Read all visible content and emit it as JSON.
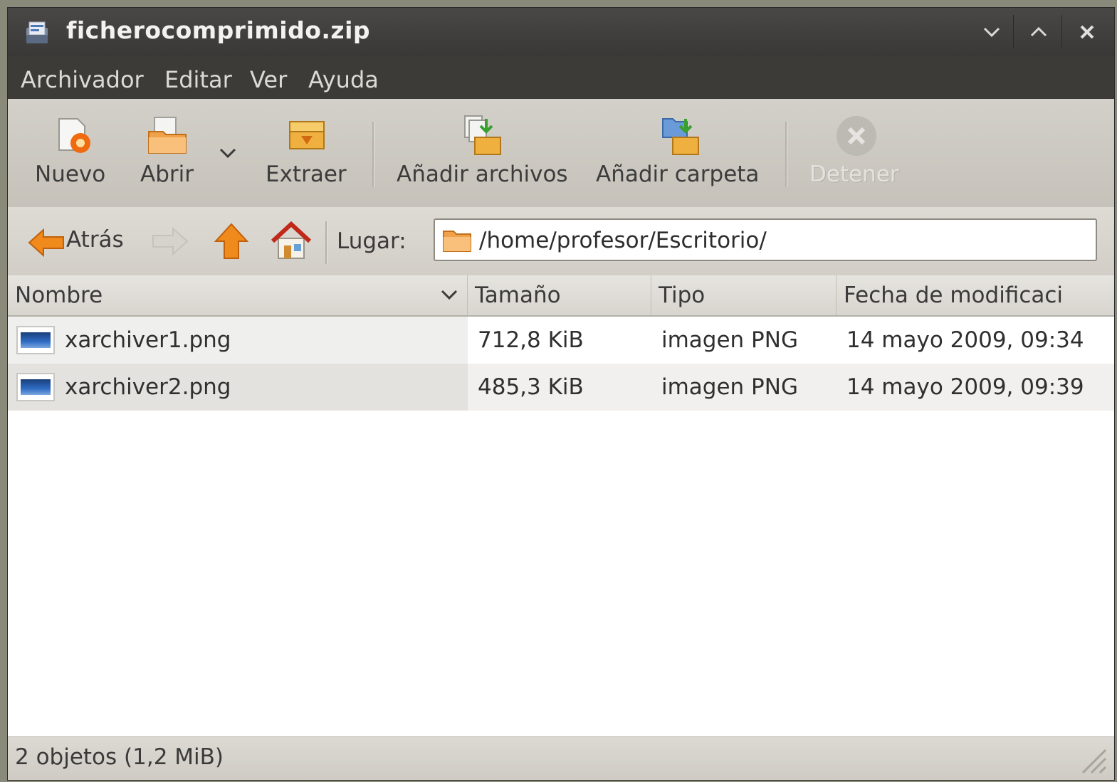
{
  "window": {
    "title": "ficherocomprimido.zip",
    "controls": {
      "minimize": "⌄",
      "maximize": "⌃",
      "close": "✕"
    }
  },
  "menu": {
    "items": [
      "Archivador",
      "Editar",
      "Ver",
      "Ayuda"
    ]
  },
  "toolbar": {
    "new_label": "Nuevo",
    "open_label": "Abrir",
    "extract_label": "Extraer",
    "add_files_label": "Añadir archivos",
    "add_folder_label": "Añadir carpeta",
    "stop_label": "Detener",
    "stop_enabled": false
  },
  "location": {
    "back_label": "Atrás",
    "label": "Lugar:",
    "path": "/home/profesor/Escritorio/"
  },
  "columns": {
    "name": "Nombre",
    "size": "Tamaño",
    "type": "Tipo",
    "modified": "Fecha de modificaci"
  },
  "files": [
    {
      "name": "xarchiver1.png",
      "size": "712,8 KiB",
      "type": "imagen PNG",
      "modified": "14 mayo 2009, 09:34"
    },
    {
      "name": "xarchiver2.png",
      "size": "485,3 KiB",
      "type": "imagen PNG",
      "modified": "14 mayo 2009, 09:39"
    }
  ],
  "status": {
    "text": "2 objetos (1,2 MiB)"
  },
  "icons": {
    "app": "archive-manager-icon",
    "new": "new-archive-icon",
    "open": "open-folder-icon",
    "extract": "extract-icon",
    "add_files": "add-files-icon",
    "add_folder": "add-folder-icon",
    "stop": "stop-icon",
    "back": "back-arrow-icon",
    "forward": "forward-arrow-icon",
    "up": "up-arrow-icon",
    "home": "home-icon",
    "folder": "folder-icon",
    "file": "png-file-icon"
  },
  "colors": {
    "titlebar": "#3c3b37",
    "toolbar": "#cdc9c2",
    "arrow_orange": "#f08a1c",
    "selected_row": "#e4e2de"
  }
}
